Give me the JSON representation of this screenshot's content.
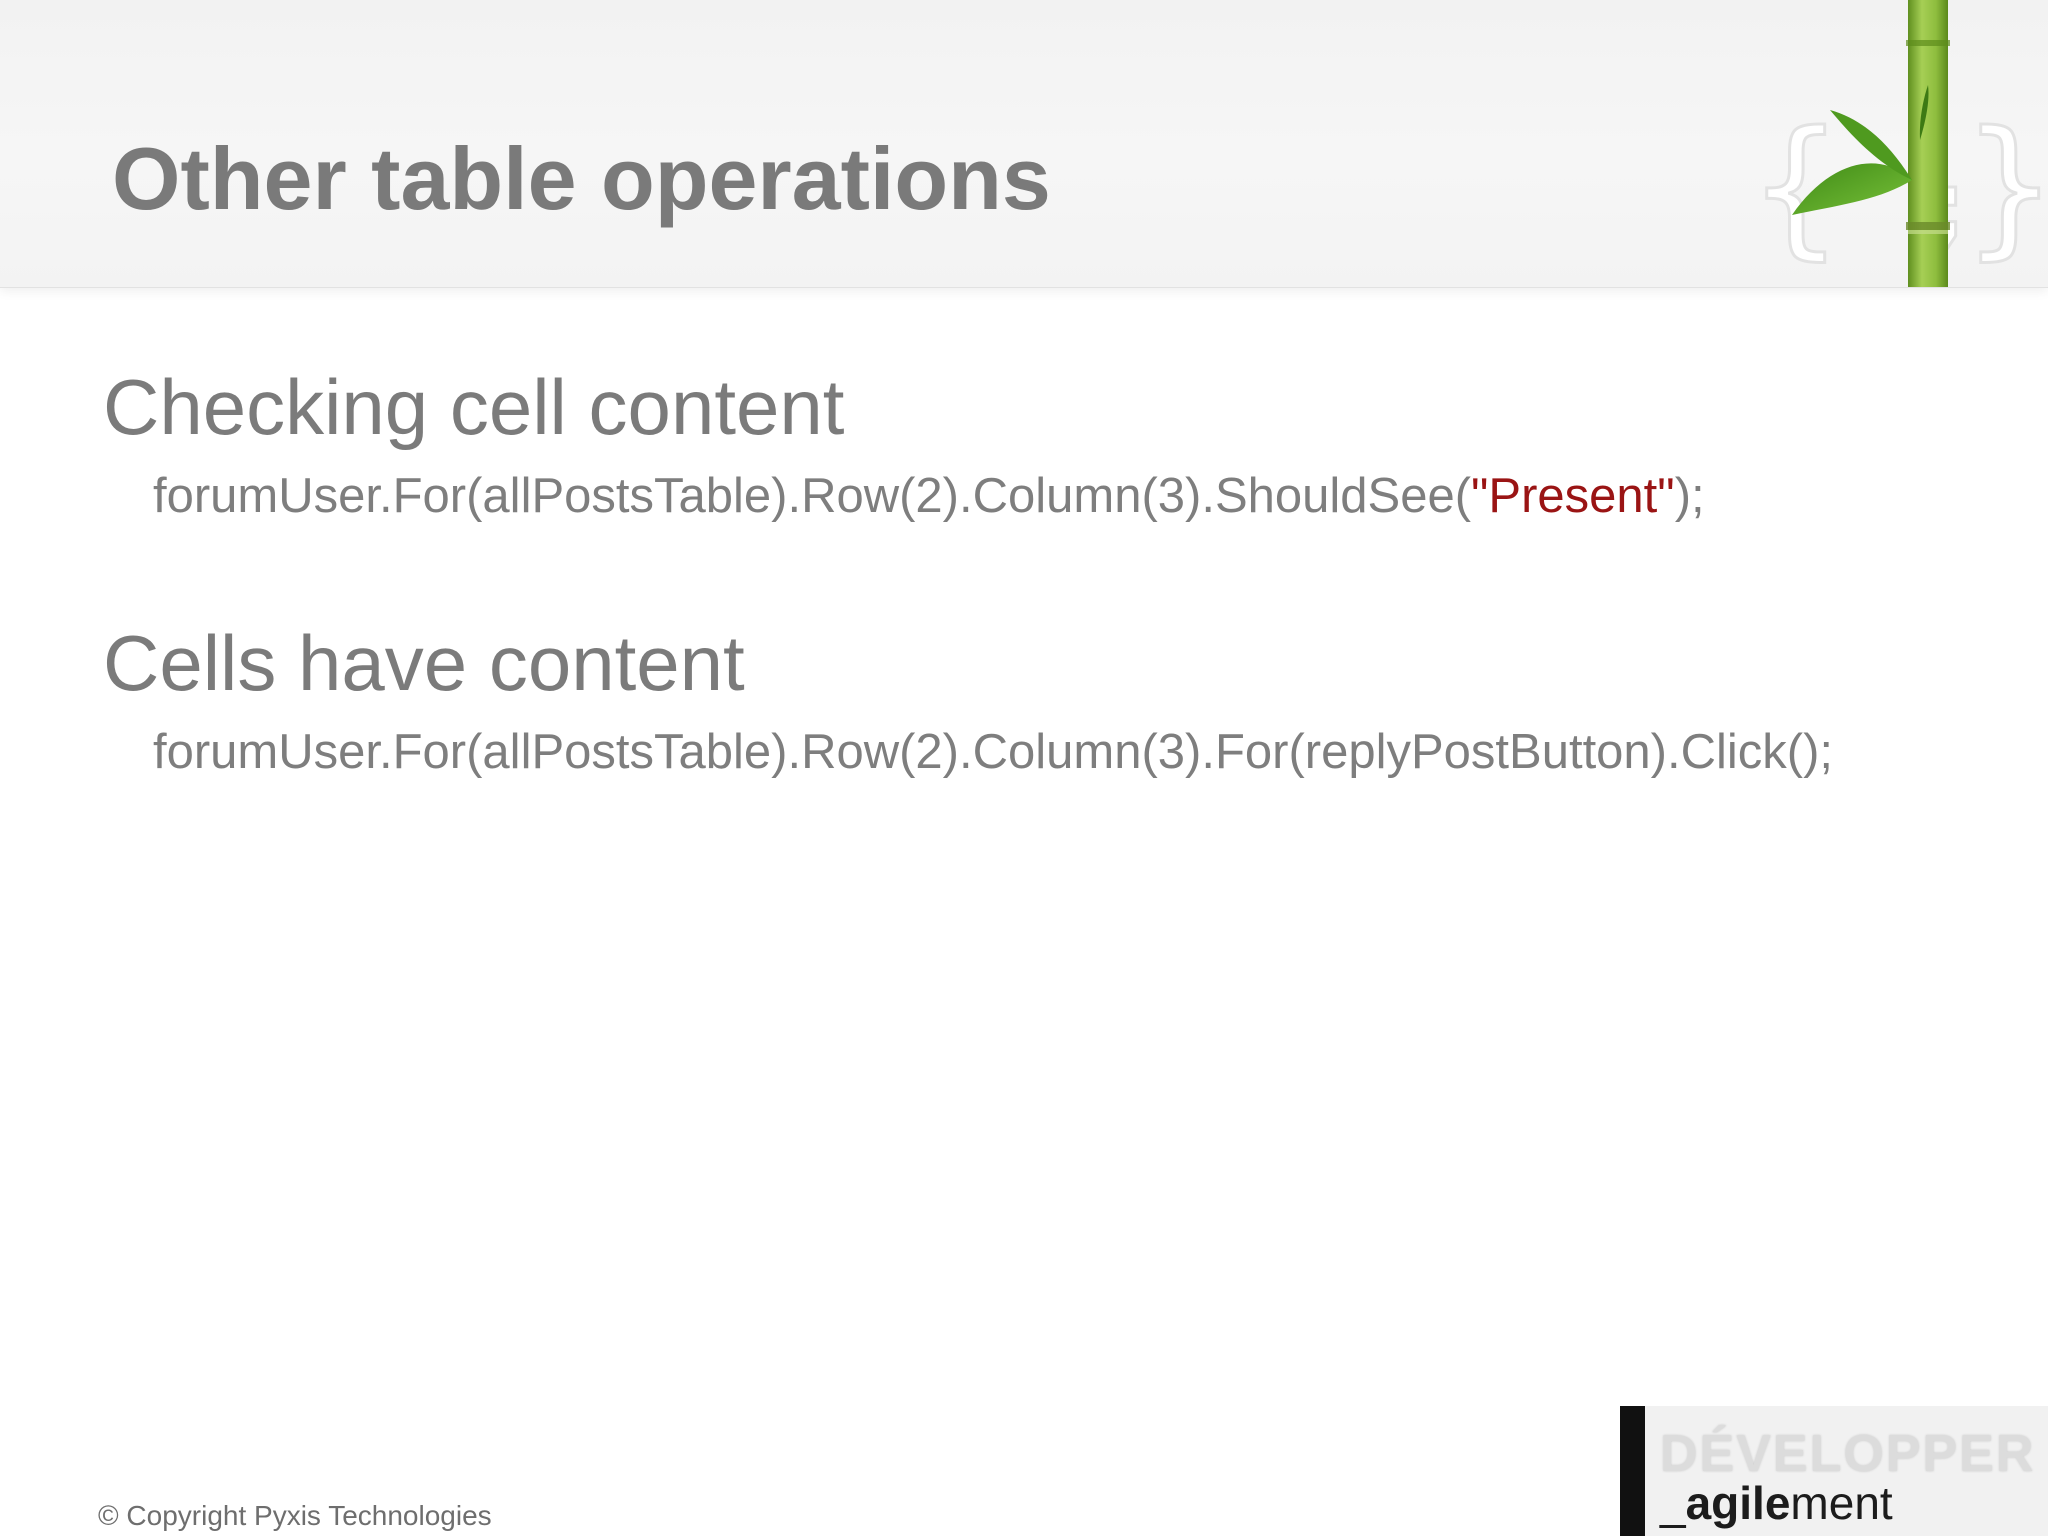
{
  "header": {
    "title": "Other table operations"
  },
  "sections": [
    {
      "heading": "Checking cell content",
      "code_prefix": "forumUser.For(allPostsTable).Row(2).Column(3).ShouldSee(",
      "code_string": "\"Present\"",
      "code_suffix": ");"
    },
    {
      "heading": "Cells have content",
      "code": "forumUser.For(allPostsTable).Row(2).Column(3).For(replyPostButton).Click();"
    }
  ],
  "footer": {
    "copyright": "© Copyright Pyxis Technologies"
  },
  "brand": {
    "line1": "DÉVELOPPER",
    "line2_prefix": "_",
    "line2_bold": "agile",
    "line2_rest": "ment"
  },
  "colors": {
    "title": "#7a7a7a",
    "body_text": "#7e7e7e",
    "string_literal": "#9a1414",
    "bamboo_green": "#7fb03a"
  },
  "icons": {
    "header_logo": "bamboo-braces-icon"
  }
}
